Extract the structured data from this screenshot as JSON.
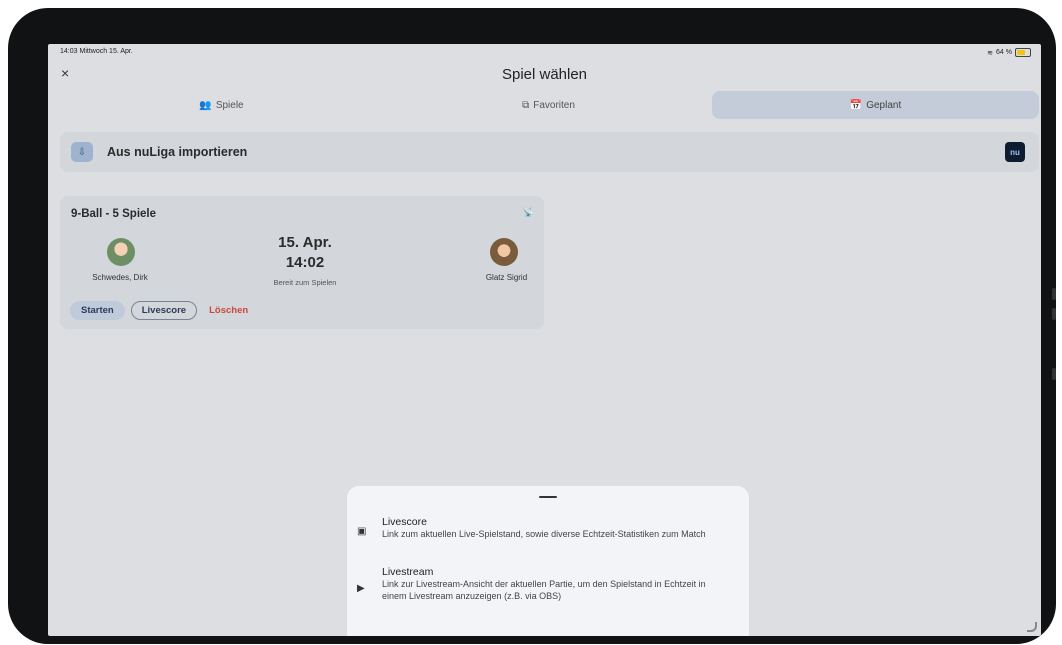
{
  "status": {
    "time": "14:03",
    "date": "Mittwoch 15. Apr.",
    "battery": "64 %"
  },
  "header": {
    "title": "Spiel wählen",
    "close": "×"
  },
  "tabs": [
    {
      "label": "Spiele",
      "icon": "players-icon",
      "glyph": "👥"
    },
    {
      "label": "Favoriten",
      "icon": "favorites-icon",
      "glyph": "⧉"
    },
    {
      "label": "Geplant",
      "icon": "calendar-icon",
      "glyph": "📅"
    }
  ],
  "import": {
    "label": "Aus nuLiga importieren",
    "logo_text": "nu"
  },
  "match": {
    "title": "9-Ball - 5 Spiele",
    "player1": "Schwedes, Dirk",
    "player2": "Glatz Sigrid",
    "date": "15. Apr.",
    "time": "14:02",
    "status": "Bereit zum Spielen",
    "start_label": "Starten",
    "livescore_label": "Livescore",
    "delete_label": "Löschen"
  },
  "sheet": {
    "items": [
      {
        "title": "Livescore",
        "description": "Link zum aktuellen Live-Spielstand, sowie diverse Echtzeit-Statistiken zum Match"
      },
      {
        "title": "Livestream",
        "description": "Link zur Livestream-Ansicht der aktuellen Partie, um den Spielstand in Echtzeit in einem Livestream anzuzeigen (z.B. via OBS)"
      }
    ]
  }
}
